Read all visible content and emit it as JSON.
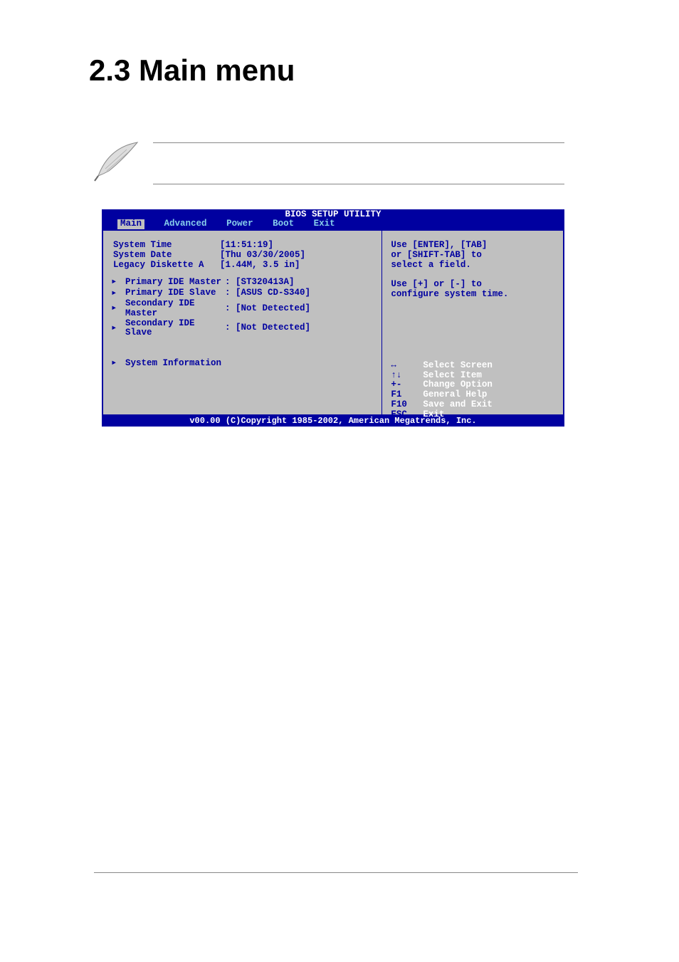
{
  "page": {
    "title": "2.3    Main menu"
  },
  "bios": {
    "title": "BIOS SETUP UTILITY",
    "menu": {
      "main": "Main",
      "advanced": "Advanced",
      "power": "Power",
      "boot": "Boot",
      "exit": "Exit"
    },
    "fields": {
      "system_time_label": "System Time",
      "system_time_value": "[11:51:19]",
      "system_date_label": "System Date",
      "system_date_value": "[Thu 03/30/2005]",
      "legacy_diskette_label": "Legacy Diskette A",
      "legacy_diskette_value": "[1.44M, 3.5 in]",
      "primary_ide_master_label": "Primary IDE Master",
      "primary_ide_master_value": ": [ST320413A]",
      "primary_ide_slave_label": "Primary IDE Slave",
      "primary_ide_slave_value": ": [ASUS CD-S340]",
      "secondary_ide_master_label": "Secondary IDE Master",
      "secondary_ide_master_value": ": [Not Detected]",
      "secondary_ide_slave_label": "Secondary IDE Slave",
      "secondary_ide_slave_value": ": [Not Detected]",
      "system_information_label": "System Information"
    },
    "help": {
      "line1": "Use [ENTER], [TAB]",
      "line2": "or [SHIFT-TAB] to",
      "line3": "select a field.",
      "line4": "Use [+] or [-] to",
      "line5": "configure system time."
    },
    "keys": {
      "k1": "↔",
      "a1": "Select Screen",
      "k2": "↑↓",
      "a2": "Select Item",
      "k3": "+-",
      "a3": "Change Option",
      "k4": "F1",
      "a4": "General Help",
      "k5": "F10",
      "a5": "Save and Exit",
      "k6": "ESC",
      "a6": "Exit"
    },
    "footer": "v00.00 (C)Copyright 1985-2002, American Megatrends, Inc."
  }
}
